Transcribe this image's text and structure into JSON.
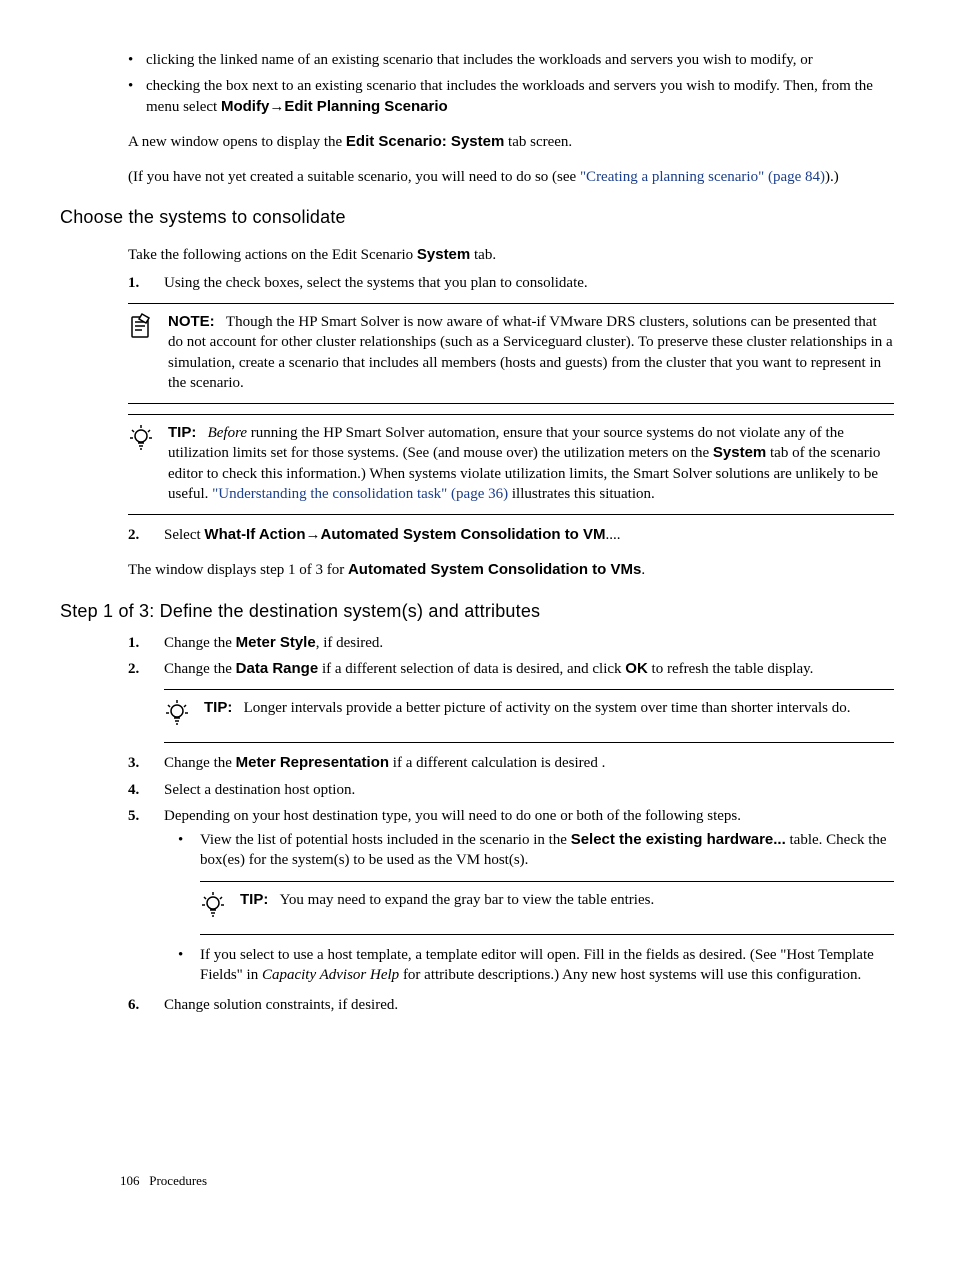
{
  "intro_bullets": [
    {
      "text_a": "clicking the linked name of an existing scenario that includes the workloads and servers you wish to modify, or"
    },
    {
      "text_a": "checking the box next to an existing scenario that includes the workloads and servers you wish to modify. Then, from the menu select ",
      "bold1": "Modify",
      "arrow": "→",
      "bold2": "Edit Planning Scenario"
    }
  ],
  "intro_p1_a": "A new window opens to display the ",
  "intro_p1_bold": "Edit Scenario: System",
  "intro_p1_b": " tab screen.",
  "intro_p2_a": "(If you have not yet created a suitable scenario, you will need to do so (see ",
  "intro_p2_link": "\"Creating a planning scenario\" (page 84)",
  "intro_p2_b": ").)",
  "h_choose": "Choose the systems to consolidate",
  "choose_p_a": "Take the following actions on the Edit Scenario ",
  "choose_p_bold": "System",
  "choose_p_b": " tab.",
  "ol1_1_num": "1.",
  "ol1_1": "Using the check boxes, select the systems that you plan to consolidate.",
  "note_label": "NOTE:",
  "note_text": "Though the HP Smart Solver is now aware of what-if VMware DRS clusters, solutions can be presented that do not account for other cluster relationships (such as a Serviceguard cluster). To preserve these cluster relationships in a simulation, create a scenario that includes all members (hosts and guests) from the cluster that you want to represent in the scenario.",
  "tip1_label": "TIP:",
  "tip1_a": "Before",
  "tip1_b": " running the HP Smart Solver automation, ensure that your source systems do not violate any of the utilization limits set for those systems. (See (and mouse over) the utilization meters on the ",
  "tip1_bold": "System",
  "tip1_c": " tab of the scenario editor to check this information.) When systems violate utilization limits, the Smart Solver solutions are unlikely to be useful. ",
  "tip1_link": "\"Understanding the consolidation task\" (page 36)",
  "tip1_d": " illustrates this situation.",
  "ol1_2_num": "2.",
  "ol1_2_a": "Select ",
  "ol1_2_b1": "What-If Action",
  "ol1_2_arrow": "→",
  "ol1_2_b2": "Automated System Consolidation to VM",
  "ol1_2_c": "....",
  "step1_p_a": "The window displays step 1 of 3 for ",
  "step1_p_bold": "Automated System Consolidation to VMs",
  "step1_p_b": ".",
  "h_step1": "Step 1 of 3: Define the destination system(s) and attributes",
  "ol2": {
    "i1_num": "1.",
    "i1_a": "Change the ",
    "i1_bold": "Meter Style",
    "i1_b": ", if desired.",
    "i2_num": "2.",
    "i2_a": "Change the ",
    "i2_bold": "Data Range",
    "i2_b": " if a different selection of data is desired, and click ",
    "i2_bold2": "OK",
    "i2_c": " to refresh the table display.",
    "tip2_label": "TIP:",
    "tip2_text": "Longer intervals provide a better picture of activity on the system over time than shorter intervals do.",
    "i3_num": "3.",
    "i3_a": "Change the ",
    "i3_bold": "Meter Representation",
    "i3_b": " if a different calculation is desired .",
    "i4_num": "4.",
    "i4": "Select a destination host option.",
    "i5_num": "5.",
    "i5": "Depending on your host destination type, you will need to do one or both of the following steps.",
    "i5_b1_a": "View the list of potential hosts included in the scenario in the ",
    "i5_b1_bold": "Select the existing hardware...",
    "i5_b1_b": " table. Check the box(es) for the system(s) to be used as the VM host(s).",
    "tip3_label": "TIP:",
    "tip3_text": "You may need to expand the gray bar to view the table entries.",
    "i5_b2_a": "If you select to use a host template, a template editor will open. Fill in the fields as desired. (See \"Host Template Fields\" in ",
    "i5_b2_ital": "Capacity Advisor Help",
    "i5_b2_b": " for attribute descriptions.) Any new host systems will use this configuration.",
    "i6_num": "6.",
    "i6": "Change solution constraints, if desired."
  },
  "footer_page": "106",
  "footer_section": "Procedures"
}
